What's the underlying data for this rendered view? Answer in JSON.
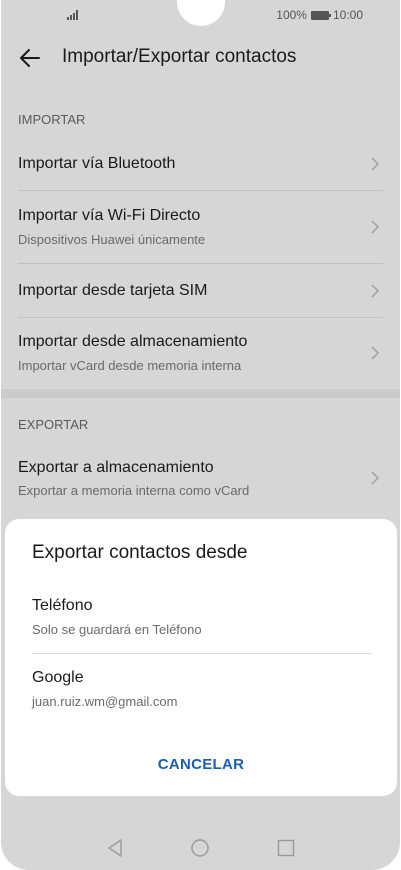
{
  "status": {
    "battery": "100%",
    "time": "10:00"
  },
  "appbar": {
    "title": "Importar/Exportar contactos"
  },
  "import_section": {
    "label": "IMPORTAR",
    "items": [
      {
        "title": "Importar vía Bluetooth",
        "subtitle": ""
      },
      {
        "title": "Importar vía Wi-Fi Directo",
        "subtitle": "Dispositivos Huawei únicamente"
      },
      {
        "title": "Importar desde tarjeta SIM",
        "subtitle": ""
      },
      {
        "title": "Importar desde almacenamiento",
        "subtitle": "Importar vCard desde memoria interna"
      }
    ]
  },
  "export_section": {
    "label": "EXPORTAR",
    "items": [
      {
        "title": "Exportar a almacenamiento",
        "subtitle": "Exportar a memoria interna como vCard"
      }
    ]
  },
  "dialog": {
    "title": "Exportar contactos desde",
    "options": [
      {
        "title": "Teléfono",
        "subtitle": "Solo se guardará en Teléfono"
      },
      {
        "title": "Google",
        "subtitle": "juan.ruiz.wm@gmail.com"
      }
    ],
    "cancel_label": "CANCELAR"
  },
  "icons": {
    "back": "arrow-left-icon",
    "chevron": "chevron-right-icon",
    "nav_back": "triangle-back-icon",
    "nav_home": "circle-home-icon",
    "nav_recent": "square-recent-icon"
  },
  "colors": {
    "accent": "#1a5fb0",
    "scrim_background": "#d6d6d6"
  }
}
